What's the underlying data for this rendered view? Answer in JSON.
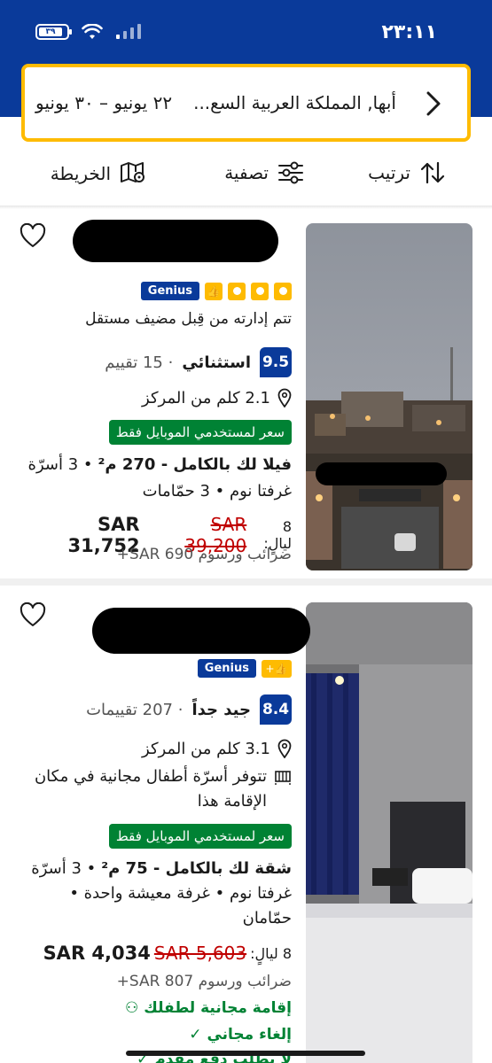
{
  "status": {
    "time": "٢٣:١١",
    "battery": "٣٩"
  },
  "search": {
    "location": "أبها, المملكة العربية السع...",
    "dates": "٢٢ يونيو  –  ٣٠ يونيو"
  },
  "toolbar": {
    "sort": "ترتيب",
    "filter": "تصفية",
    "map": "الخريطة"
  },
  "listings": [
    {
      "genius": "Genius",
      "managed_by": "تتم إدارته من قِبل مضيف مستقل",
      "score": "9.5",
      "grade": "استثنائي",
      "reviews": "· 15 تقييم",
      "distance": "2.1 كلم من المركز",
      "mobile_badge": "سعر لمستخدمي الموبايل فقط",
      "unit_title": "فيلا لك بالكامل - 270 م²",
      "unit_beds": "• 3 أسرّة",
      "unit_rooms": "غرفتا نوم • 3 حمّامات",
      "nights": "8 ليالٍ:",
      "price_old": "SAR 39,200",
      "price_new": "SAR 31,752",
      "taxes": "ضرائب ورسوم SAR 690+"
    },
    {
      "genius": "Genius",
      "score": "8.4",
      "grade": "جيد جداً",
      "reviews": "· 207 تقييمات",
      "distance": "3.1 كلم من المركز",
      "cribs_1": "تتوفر أسرّة أطفال مجانية في مكان",
      "cribs_2": "الإقامة هذا",
      "mobile_badge": "سعر لمستخدمي الموبايل فقط",
      "unit_title": "شقة لك بالكامل - 75 م²",
      "unit_beds": "• 3 أسرّة",
      "unit_rooms": "غرفتا نوم • غرفة معيشة واحدة •",
      "unit_baths": "حمّامان",
      "nights": "8 ليالٍ:",
      "price_old": "SAR 5,603",
      "price_new": "SAR 4,034",
      "taxes": "ضرائب ورسوم SAR 807+",
      "perk_child": "إقامة مجانية لطفلك",
      "perk_cancel": "إلغاء مجاني",
      "perk_prepay": "لا يطلب دفع مقدم"
    }
  ],
  "colors": {
    "brand": "#0a3a9a",
    "accent": "#febb02",
    "green": "#008234",
    "red": "#c00000"
  }
}
